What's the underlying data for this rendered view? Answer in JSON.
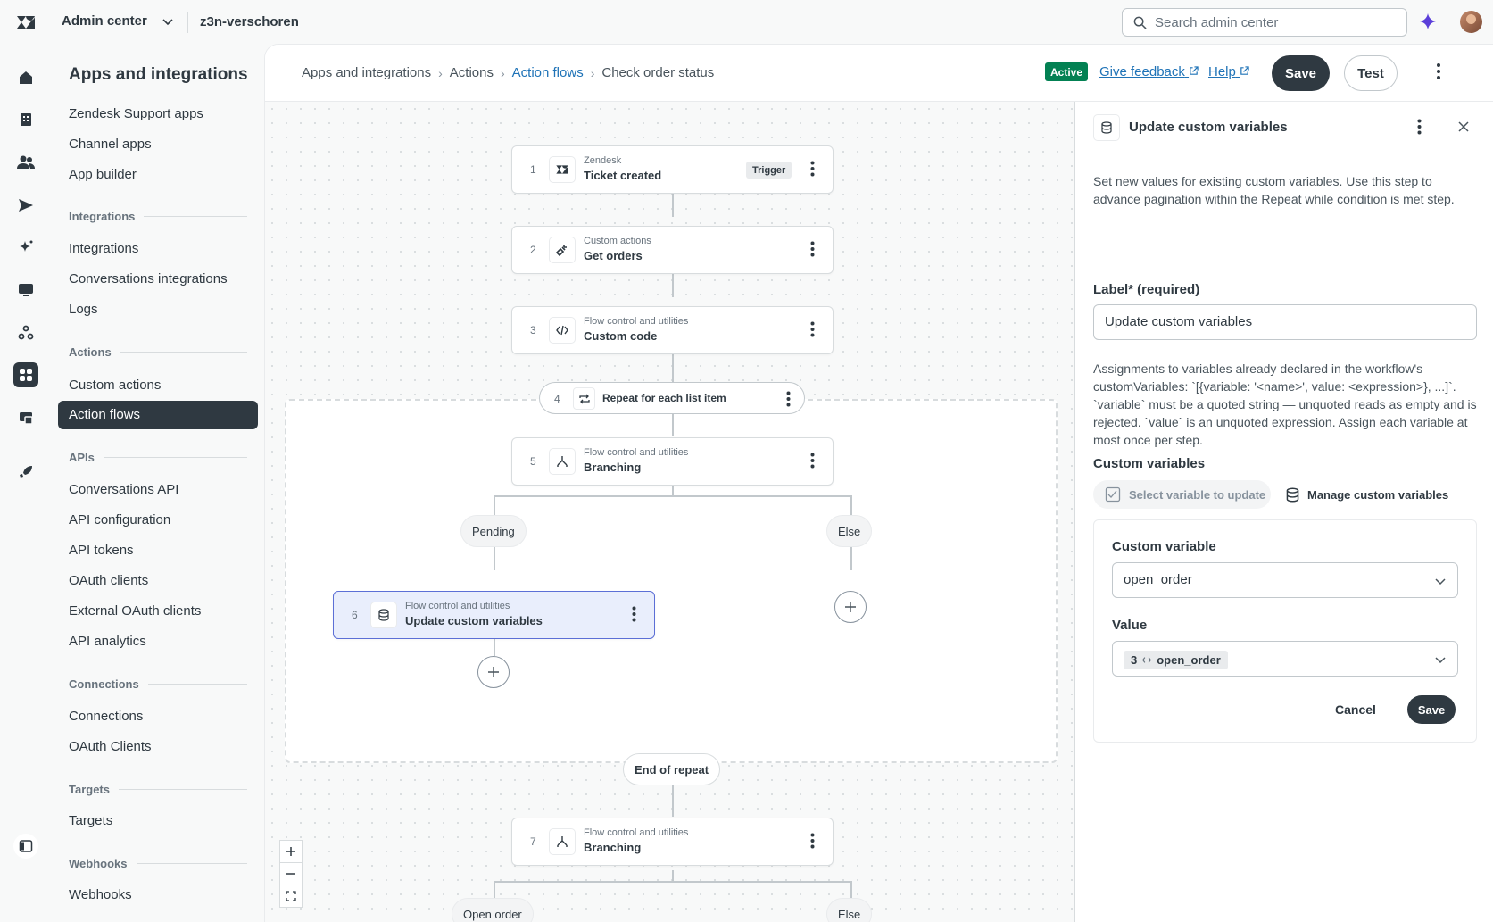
{
  "topbar": {
    "product_label": "Admin center",
    "subdomain": "z3n-verschoren",
    "search_placeholder": "Search admin center"
  },
  "sidenav": {
    "title": "Apps and integrations",
    "items_top": [
      "Zendesk Support apps",
      "Channel apps",
      "App builder"
    ],
    "integrations_head": "Integrations",
    "integrations": [
      "Integrations",
      "Conversations integrations",
      "Logs"
    ],
    "actions_head": "Actions",
    "actions": [
      "Custom actions",
      "Action flows"
    ],
    "apis_head": "APIs",
    "apis": [
      "Conversations API",
      "API configuration",
      "API tokens",
      "OAuth clients",
      "External OAuth clients",
      "API analytics"
    ],
    "connections_head": "Connections",
    "connections": [
      "Connections",
      "OAuth Clients"
    ],
    "targets_head": "Targets",
    "targets": [
      "Targets"
    ],
    "webhooks_head": "Webhooks",
    "webhooks": [
      "Webhooks"
    ]
  },
  "header": {
    "crumbs": [
      "Apps and integrations",
      "Actions",
      "Action flows",
      "Check order status"
    ],
    "status": "Active",
    "feedback": "Give feedback",
    "help": "Help",
    "save": "Save",
    "test": "Test"
  },
  "flow": {
    "steps": [
      {
        "num": "1",
        "category": "Zendesk",
        "title": "Ticket created",
        "tag": "Trigger",
        "icon": "zendesk-icon"
      },
      {
        "num": "2",
        "category": "Custom actions",
        "title": "Get orders",
        "icon": "plug-icon"
      },
      {
        "num": "3",
        "category": "Flow control and utilities",
        "title": "Custom code",
        "icon": "code-icon"
      },
      {
        "num": "4",
        "title": "Repeat for each list item",
        "icon": "repeat-icon"
      },
      {
        "num": "5",
        "category": "Flow control and utilities",
        "title": "Branching",
        "icon": "branch-icon"
      },
      {
        "num": "6",
        "category": "Flow control and utilities",
        "title": "Update custom variables",
        "icon": "database-icon"
      },
      {
        "num": "7",
        "category": "Flow control and utilities",
        "title": "Branching",
        "icon": "branch-icon"
      }
    ],
    "branch_a": "Pending",
    "branch_b": "Else",
    "end_repeat": "End of repeat",
    "branch_c": "Open order",
    "branch_d": "Else"
  },
  "panel": {
    "title": "Update custom variables",
    "description": "Set new values for existing custom variables. Use this step to advance pagination within the Repeat while condition is met step.",
    "label_field_label": "Label* (required)",
    "label_field_value": "Update custom variables",
    "assign_description": "Assignments to variables already declared in the workflow's customVariables: `[{variable: '<name>', value: <expression>}, ...]`. `variable` must be a quoted string — unquoted reads as empty and is rejected. `value` is an unquoted expression. Assign each variable at most once per step.",
    "custom_vars_label": "Custom variables",
    "select_var_btn": "Select variable to update",
    "manage_btn": "Manage custom variables",
    "cv_label": "Custom variable",
    "cv_value": "open_order",
    "value_label": "Value",
    "value_step": "3",
    "value_token": "open_order",
    "cancel": "Cancel",
    "save": "Save"
  }
}
